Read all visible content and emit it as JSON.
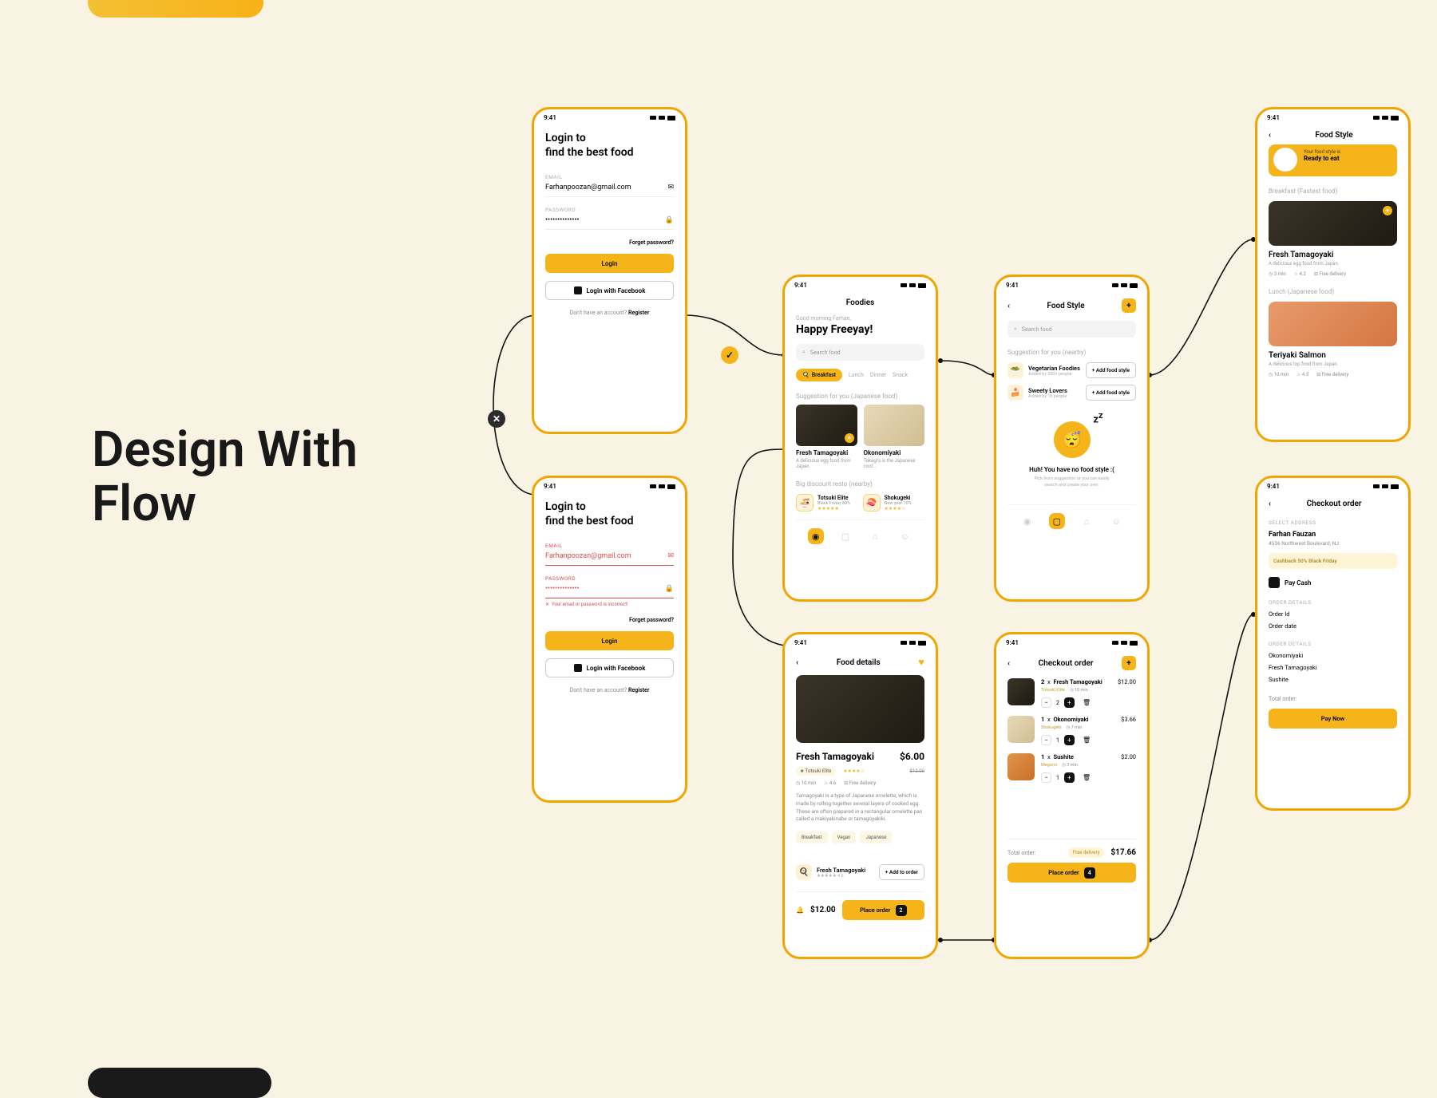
{
  "page": {
    "title_l1": "Design With",
    "title_l2": "Flow"
  },
  "status_time": "9:41",
  "login": {
    "heading_l1": "Login to",
    "heading_l2": "find the best food",
    "email_label": "EMAIL",
    "email_value": "Farhanpoozan@gmail.com",
    "password_label": "PASSWORD",
    "password_value": "••••••••••••••",
    "forgot": "Forget password?",
    "login_btn": "Login",
    "fb_btn": "Login with Facebook",
    "register_prefix": "Don't have an account? ",
    "register": "Register",
    "error_msg": "Your email or password is incorrect!"
  },
  "home": {
    "title": "Foodies",
    "greet_small": "Good morning Farhan,",
    "greet_big": "Happy Freeyay!",
    "search_ph": "Search food",
    "chips": [
      "Breakfast",
      "Lunch",
      "Dinner",
      "Snack"
    ],
    "sec_suggest": "Suggestion for you",
    "sec_suggest_sub": "(Japanese food)",
    "card1_t": "Fresh Tamagoyaki",
    "card1_s": "A delicious egg food from Japan.",
    "card2_t": "Okonomiyaki",
    "card2_s": "Takagi's is the Japanese cool...",
    "sec_resto": "Big discount resto",
    "sec_resto_sub": "(nearby)",
    "resto1_t": "Totsuki Elite",
    "resto1_s": "Black Friday 80%",
    "resto2_t": "Shokugeki",
    "resto2_s": "New year 70%"
  },
  "style": {
    "title": "Food Style",
    "search_ph": "Search food",
    "sec": "Suggestion for you",
    "sec_sub": "(nearby)",
    "s1_t": "Vegetarian Foodies",
    "s1_s": "Added by 200+ people",
    "s2_t": "Sweety Lovers",
    "s2_s": "Added by 10 people",
    "add_btn": "+ Add food style",
    "empty_t": "Huh! You have no food style :(",
    "empty_s1": "Pick from suggestion or you can easily",
    "empty_s2": "search and create your own."
  },
  "detail": {
    "title": "Food details",
    "dish": "Fresh Tamagoyaki",
    "price": "$6.00",
    "old_price": "$12.00",
    "seller": "Totsuki Elite",
    "meta_time": "10 min",
    "meta_rating": "4.6",
    "meta_delivery": "Free delivery",
    "desc": "Tamagoyaki is a type of Japanese omelette, which is made by rolling together several layers of cooked egg. These are often prepared in a rectangular omelette pan called a makiyakinabe or tamagoyakiki.",
    "tags": [
      "Breakfast",
      "Vegan",
      "Japanese"
    ],
    "seller2_t": "Fresh Tamagoyaki",
    "seller2_s": "★★★★★ 4.6",
    "add_order": "+ Add to order",
    "total": "$12.00",
    "place": "Place order",
    "place_n": "2"
  },
  "checkout": {
    "title": "Checkout order",
    "i1_q": "2",
    "i1_t": "Fresh Tamagoyaki",
    "i1_p": "$12.00",
    "i1_s": "Totsuki Elite",
    "i1_time": "10 min",
    "i2_q": "1",
    "i2_t": "Okonomiyaki",
    "i2_p": "$3.66",
    "i2_s": "Shokugeki",
    "i2_time": "7 min",
    "i3_q": "1",
    "i3_t": "Sushite",
    "i3_p": "$2.00",
    "i3_s": "Megumi",
    "i3_time": "3 min",
    "total_l": "Total order:",
    "free": "Free delivery",
    "total_v": "$17.66",
    "place": "Place order",
    "place_n": "4"
  },
  "style2": {
    "title": "Food Style",
    "ready_small": "Your food style is",
    "ready": "Ready to eat",
    "bk_t": "Breakfast",
    "bk_s": "(Fastest food)",
    "d1_t": "Fresh Tamagoyaki",
    "d1_s": "A delicious egg food from Japan.",
    "m1": "3 min",
    "m2": "4.2",
    "m3": "Free delivery",
    "lu_t": "Lunch",
    "lu_s": "(Japanese food)",
    "d2_t": "Teriyaki Salmon",
    "d2_s": "A delicious top food from Japan.",
    "m4": "10 min",
    "m5": "4.5",
    "m6": "Free delivery"
  },
  "final": {
    "title": "Checkout order",
    "addr_h": "SELECT ADDRESS",
    "name": "Farhan Fauzan",
    "addr": "4536 Northwest Boulevard, NJ",
    "cash": "Cashback 50% Black Friday",
    "pay": "Pay Cash",
    "od_h": "ORDER DETAILS",
    "id_l": "Order Id",
    "date_l": "Order date",
    "items_h": "ORDER DETAILS",
    "it1": "Okonomiyaki",
    "it2": "Fresh Tamagoyaki",
    "it3": "Sushite",
    "total_l": "Total order:",
    "paynow": "Pay Now"
  }
}
